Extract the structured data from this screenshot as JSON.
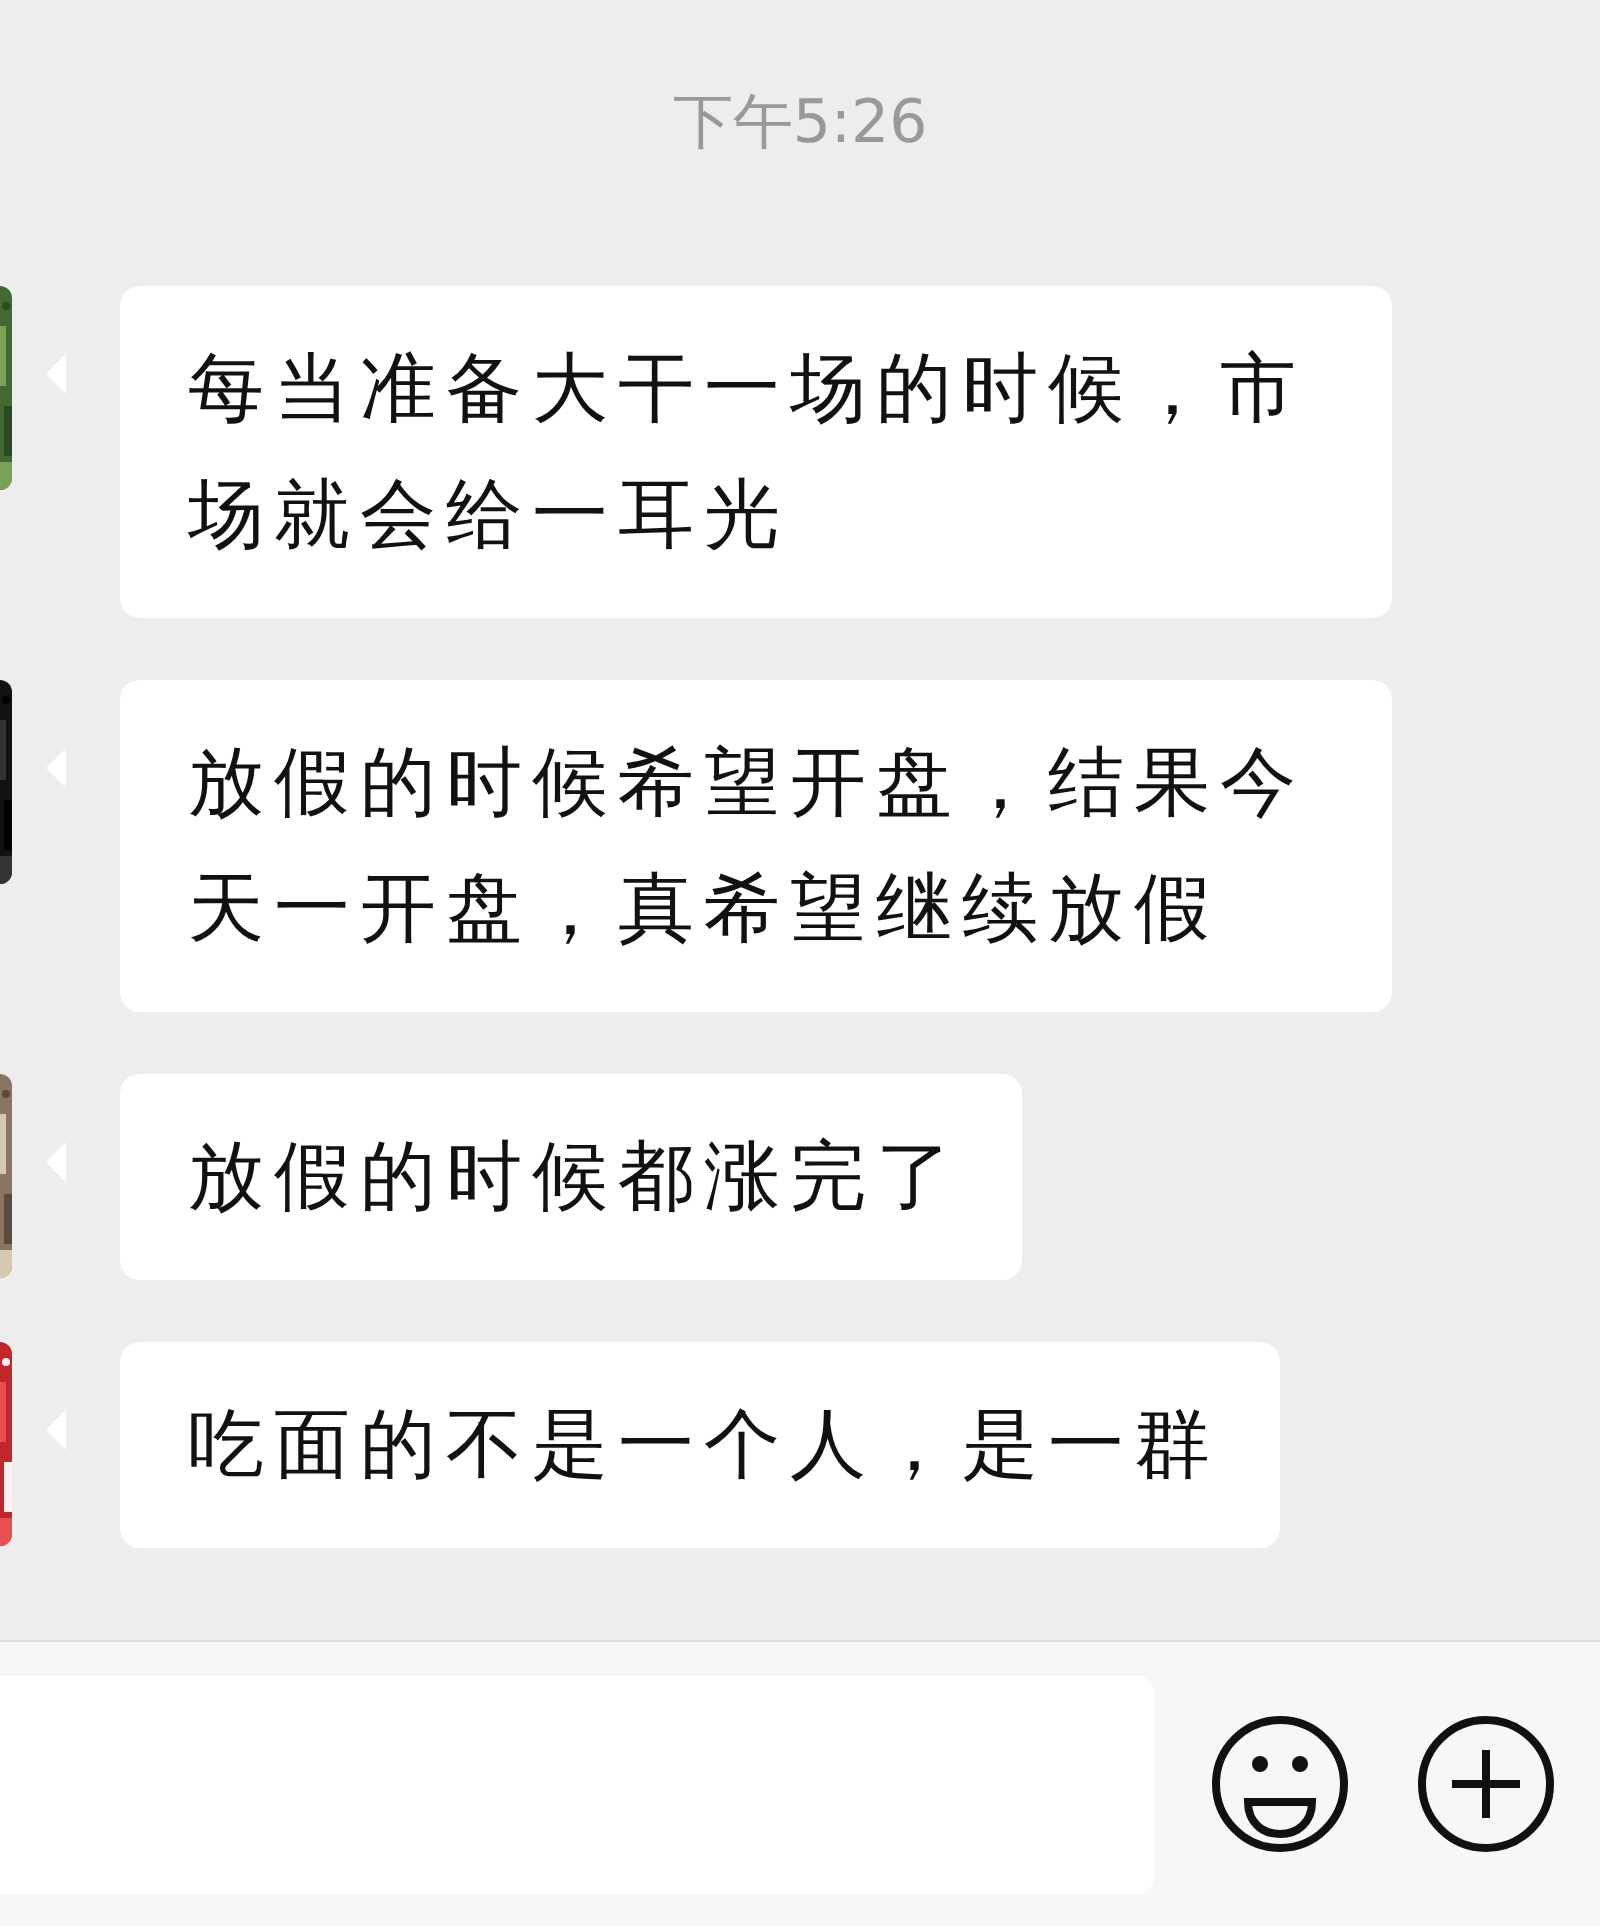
{
  "timestamp": "下午5:26",
  "messages": [
    {
      "text": "每当准备大干一场的时候，市场就会给一耳光"
    },
    {
      "text": "放假的时候希望开盘，结果今天一开盘，真希望继续放假"
    },
    {
      "text": "放假的时候都涨完了"
    },
    {
      "text": "吃面的不是一个人，是一群"
    }
  ]
}
